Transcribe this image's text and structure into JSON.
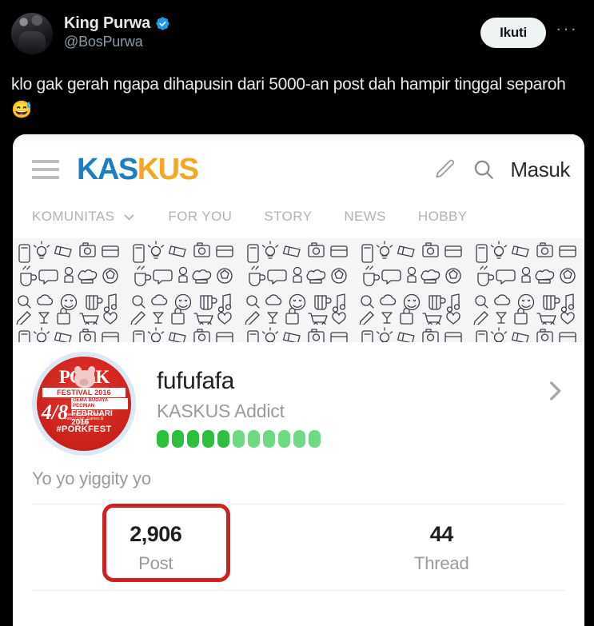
{
  "tweet": {
    "display_name": "King Purwa",
    "verified": true,
    "handle": "@BosPurwa",
    "follow_label": "Ikuti",
    "more_label": "···",
    "body": "klo gak gerah ngapa dihapusin dari 5000-an post dah hampir tinggal separoh ",
    "body_emoji": "😅",
    "colors": {
      "background": "#000000",
      "text": "#e7e9ea",
      "muted": "#8b98a5",
      "verified_blue": "#1d9bf0",
      "follow_bg": "#eff3f4"
    }
  },
  "kaskus": {
    "header": {
      "menu_icon": "hamburger-icon",
      "logo_part_1": "KAS",
      "logo_part_2": "KUS",
      "logo_color_1": "#1c7fc4",
      "logo_color_2": "#f5a623",
      "pencil_icon": "pencil-icon",
      "search_icon": "search-icon",
      "login_label": "Masuk"
    },
    "nav": [
      {
        "label": "KOMUNITAS",
        "has_chevron": true
      },
      {
        "label": "FOR YOU",
        "has_chevron": false
      },
      {
        "label": "STORY",
        "has_chevron": false
      },
      {
        "label": "NEWS",
        "has_chevron": false
      },
      {
        "label": "HOBBY",
        "has_chevron": false
      }
    ],
    "banner": {
      "description": "doodle-pattern-banner"
    },
    "profile": {
      "avatar": {
        "title": "PORK",
        "subtitle": "FESTIVAL 2016",
        "date": "4/8",
        "month": "FEBRUARI 2016",
        "small_line": "GEMA BUDAYA PECINAN",
        "hashtag": "#PORKFEST",
        "detail_line": "Free Entry, Live Music,\nFood Court, Games & More"
      },
      "username": "fufufafa",
      "user_title": "KASKUS Addict",
      "reputation_dots_filled": 5,
      "reputation_dots_empty": 6,
      "reputation_color_filled": "#2fbf3f",
      "reputation_color_empty": "#6edb84",
      "chevron_icon": "chevron-right-icon",
      "status_text": "Yo yo yiggity yo"
    },
    "stats": [
      {
        "value": "2,906",
        "label": "Post",
        "highlighted": true
      },
      {
        "value": "44",
        "label": "Thread",
        "highlighted": false
      }
    ],
    "highlight_color": "#cc2222"
  }
}
